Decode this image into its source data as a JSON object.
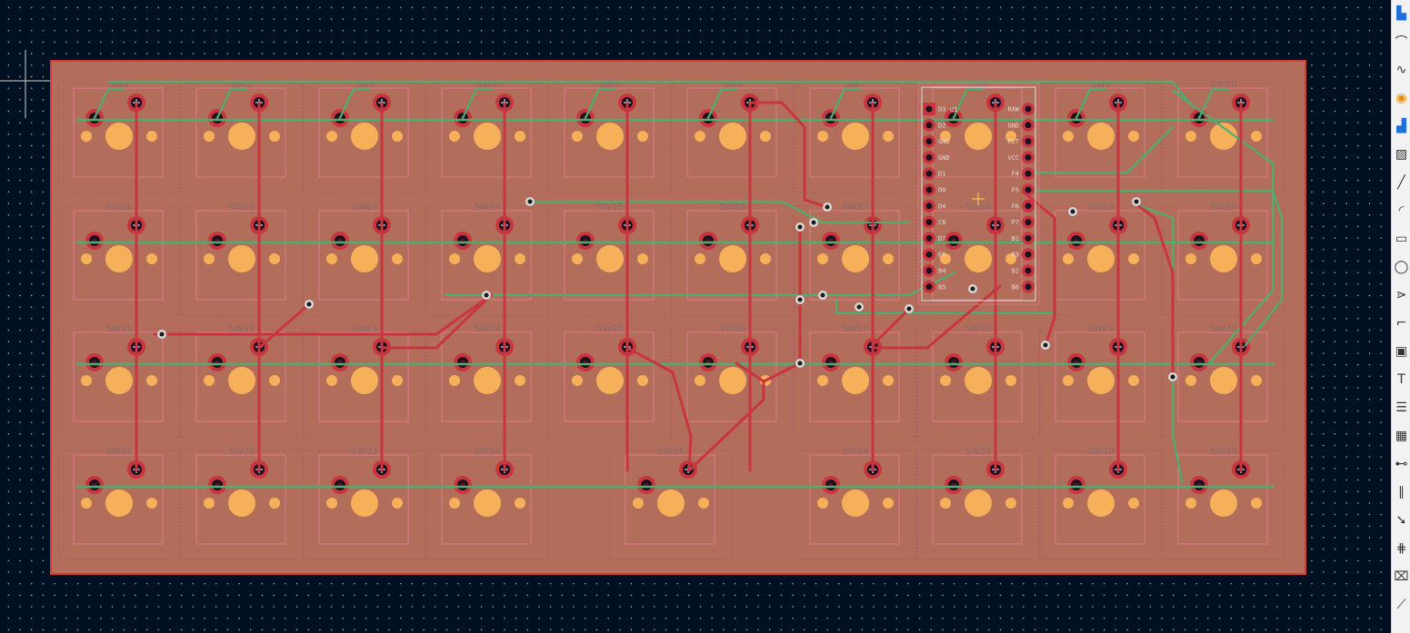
{
  "board": {
    "switches": [
      {
        "label": "SW1"
      },
      {
        "label": "SW2"
      },
      {
        "label": "SW3"
      },
      {
        "label": "SW4"
      },
      {
        "label": "SW5"
      },
      {
        "label": "SW6"
      },
      {
        "label": "SW7"
      },
      {
        "label": "SW8"
      },
      {
        "label": "SW9"
      },
      {
        "label": "SW10"
      },
      {
        "label": "SW11"
      },
      {
        "label": "SW12"
      },
      {
        "label": "SW13"
      },
      {
        "label": "SW14"
      },
      {
        "label": "SW15"
      },
      {
        "label": "SW16"
      },
      {
        "label": "SW17"
      },
      {
        "label": "SW18"
      },
      {
        "label": "SW19"
      },
      {
        "label": "SW20"
      },
      {
        "label": "SW21"
      },
      {
        "label": "SW22"
      },
      {
        "label": "SW23"
      },
      {
        "label": "SW24"
      },
      {
        "label": "SW25"
      },
      {
        "label": "SW26"
      },
      {
        "label": "SW27"
      },
      {
        "label": "SW28"
      },
      {
        "label": "SW29"
      },
      {
        "label": "SW30"
      },
      {
        "label": "SW31"
      },
      {
        "label": "SW32"
      },
      {
        "label": "SW33"
      },
      {
        "label": "SW34"
      },
      {
        "label": "SW35"
      },
      {
        "label": "SW36"
      },
      {
        "label": "SW37"
      },
      {
        "label": "SW38"
      },
      {
        "label": "SW39"
      }
    ],
    "mcu": {
      "ref": "U1",
      "left_pins": [
        "D3",
        "D2",
        "GND",
        "GND",
        "D1",
        "D0",
        "D4",
        "C6",
        "D7",
        "E6",
        "B4",
        "B5"
      ],
      "right_pins": [
        "RAW",
        "GND",
        "RST",
        "VCC",
        "F4",
        "F5",
        "F6",
        "F7",
        "B1",
        "B3",
        "B2",
        "B6"
      ]
    },
    "colors": {
      "background": "#001023",
      "board_fill": "#b26e5a",
      "edge_cuts": "#d23c3c",
      "front_copper": "#c8353e",
      "back_copper": "#4caf70",
      "pad": "#f7b05a",
      "courtyard": "#e07a8a"
    }
  },
  "toolbar": {
    "tools": [
      {
        "icon": "inspect-icon",
        "glyph": "▙"
      },
      {
        "icon": "route-track-icon",
        "glyph": "⌒"
      },
      {
        "icon": "tune-length-icon",
        "glyph": "∿"
      },
      {
        "icon": "via-icon",
        "glyph": "◉"
      },
      {
        "icon": "zone-icon",
        "glyph": "▟"
      },
      {
        "icon": "rule-area-icon",
        "glyph": "▨"
      },
      {
        "icon": "draw-line-icon",
        "glyph": "╱"
      },
      {
        "icon": "draw-arc-icon",
        "glyph": "◜"
      },
      {
        "icon": "draw-rectangle-icon",
        "glyph": "▭"
      },
      {
        "icon": "draw-circle-icon",
        "glyph": "◯"
      },
      {
        "icon": "draw-polygon-icon",
        "glyph": "⋗"
      },
      {
        "icon": "curve-icon",
        "glyph": "⌐"
      },
      {
        "icon": "image-icon",
        "glyph": "▣"
      },
      {
        "icon": "text-icon",
        "glyph": "T"
      },
      {
        "icon": "textbox-icon",
        "glyph": "☰"
      },
      {
        "icon": "table-icon",
        "glyph": "▦"
      },
      {
        "icon": "dimension-icon",
        "glyph": "⊷"
      },
      {
        "icon": "barcode-icon",
        "glyph": "∥"
      },
      {
        "icon": "delete-tool-icon",
        "glyph": "➘"
      },
      {
        "icon": "grid-origin-icon",
        "glyph": "⋕"
      },
      {
        "icon": "drill-origin-icon",
        "glyph": "⌧"
      },
      {
        "icon": "measure-icon",
        "glyph": "⟋"
      }
    ]
  }
}
